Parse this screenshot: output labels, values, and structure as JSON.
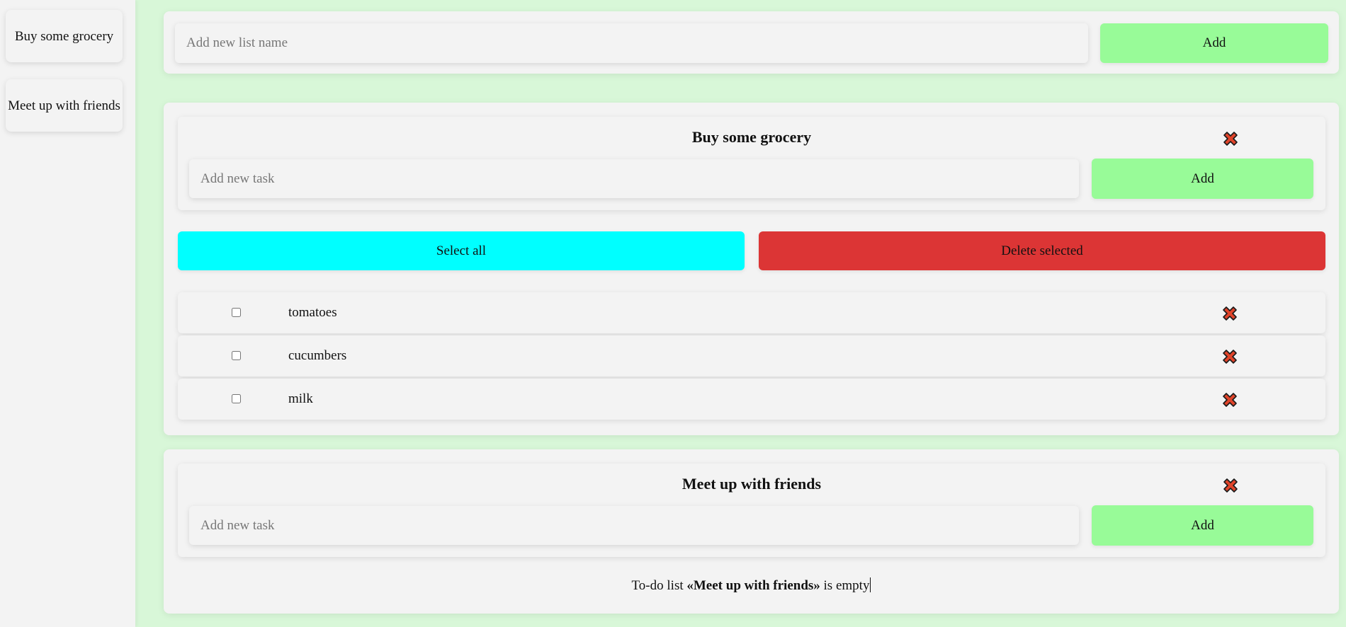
{
  "sidebar": {
    "items": [
      {
        "label": "Buy some grocery"
      },
      {
        "label": "Meet up with friends"
      }
    ]
  },
  "new_list": {
    "placeholder": "Add new list name",
    "add_label": "Add"
  },
  "lists": [
    {
      "title": "Buy some grocery",
      "new_task_placeholder": "Add new task",
      "add_label": "Add",
      "select_all_label": "Select all",
      "delete_selected_label": "Delete selected",
      "tasks": [
        {
          "label": "tomatoes",
          "checked": false
        },
        {
          "label": "cucumbers",
          "checked": false
        },
        {
          "label": "milk",
          "checked": false
        }
      ]
    },
    {
      "title": "Meet up with friends",
      "new_task_placeholder": "Add new task",
      "add_label": "Add",
      "empty": {
        "prefix": "To-do list ",
        "name": "«Meet up with friends»",
        "suffix": " is empty"
      }
    }
  ],
  "colors": {
    "background": "#d8f7d8",
    "panel": "#f3f3f3",
    "add_button": "#98fb98",
    "select_all_button": "#00ffff",
    "delete_selected_button": "#dc3535",
    "delete_icon": "#e0442a"
  },
  "icons": {
    "delete": "close-icon"
  }
}
